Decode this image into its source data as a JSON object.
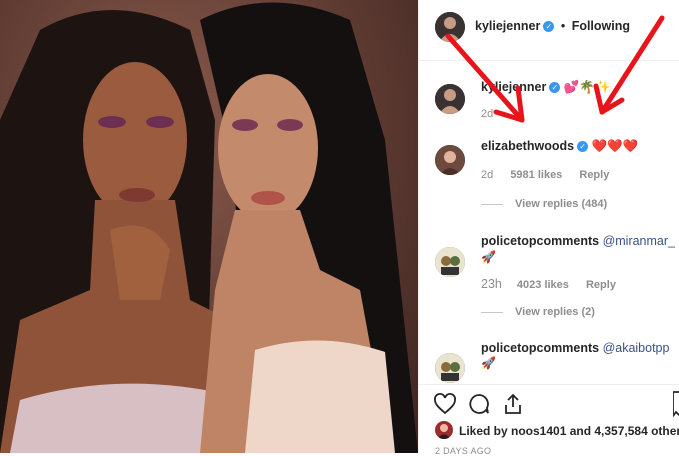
{
  "header": {
    "username": "kyliejenner",
    "separator": "•",
    "follow_status": "Following"
  },
  "caption": {
    "username": "kyliejenner",
    "emojis": "💕🌴✨",
    "time": "2d"
  },
  "comments": [
    {
      "username": "elizabethwoods",
      "verified": true,
      "text": "❤️❤️❤️",
      "time": "2d",
      "likes": "5981 likes",
      "reply": "Reply",
      "view_replies": "View replies (484)"
    },
    {
      "username": "policetopcomments",
      "verified": false,
      "mention": "@miranmar_",
      "emoji": "🚀",
      "time": "23h",
      "likes": "4023 likes",
      "reply": "Reply",
      "view_replies": "View replies (2)"
    },
    {
      "username": "policetopcomments",
      "verified": false,
      "mention": "@akaibotpp",
      "emoji": "🚀"
    }
  ],
  "footer": {
    "liked_by": "Liked by noos1401 and 4,357,584 other",
    "date": "2 DAYS AGO"
  },
  "colors": {
    "arrow": "#e8141b",
    "verified": "#3897f0",
    "mention": "#385185"
  }
}
